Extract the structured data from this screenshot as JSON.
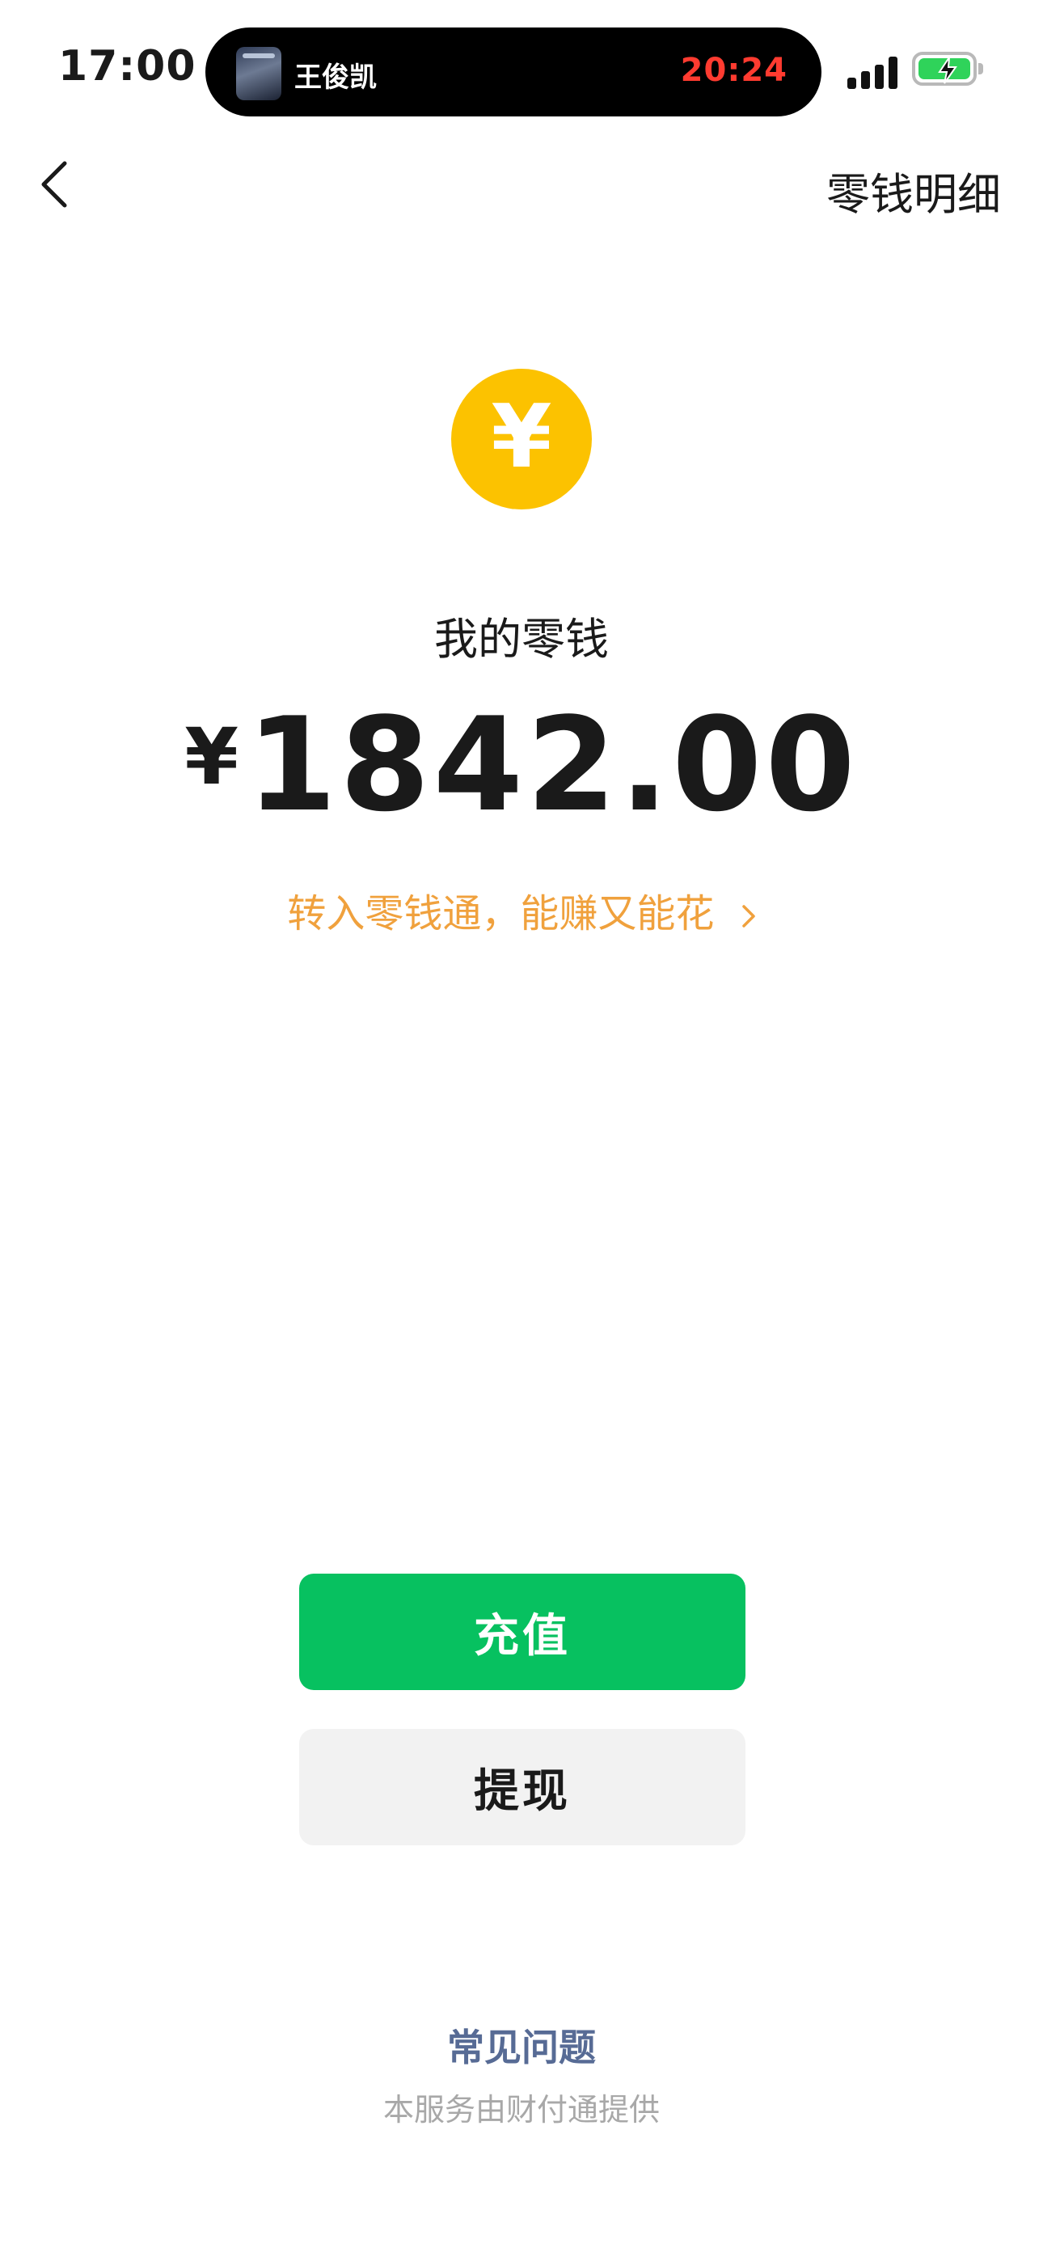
{
  "status_bar": {
    "time": "17:00",
    "now_playing_artist": "王俊凯",
    "timer": "20:24",
    "icons": [
      "signal-icon",
      "battery-charging-icon"
    ],
    "battery_color": "#2fd35a"
  },
  "nav": {
    "back_icon": "chevron-left-icon",
    "details_link": "零钱明细"
  },
  "balance": {
    "coin_glyph": "¥",
    "label": "我的零钱",
    "currency_symbol": "¥",
    "amount": "1842.00",
    "promo_text": "转入零钱通，能赚又能花"
  },
  "actions": {
    "recharge_label": "充值",
    "withdraw_label": "提现"
  },
  "footer": {
    "faq_link": "常见问题",
    "provider_text": "本服务由财付通提供"
  },
  "colors": {
    "accent_green": "#07c160",
    "coin_yellow": "#fcc200",
    "promo_orange": "#f0a13d",
    "link_blue": "#576b95"
  }
}
